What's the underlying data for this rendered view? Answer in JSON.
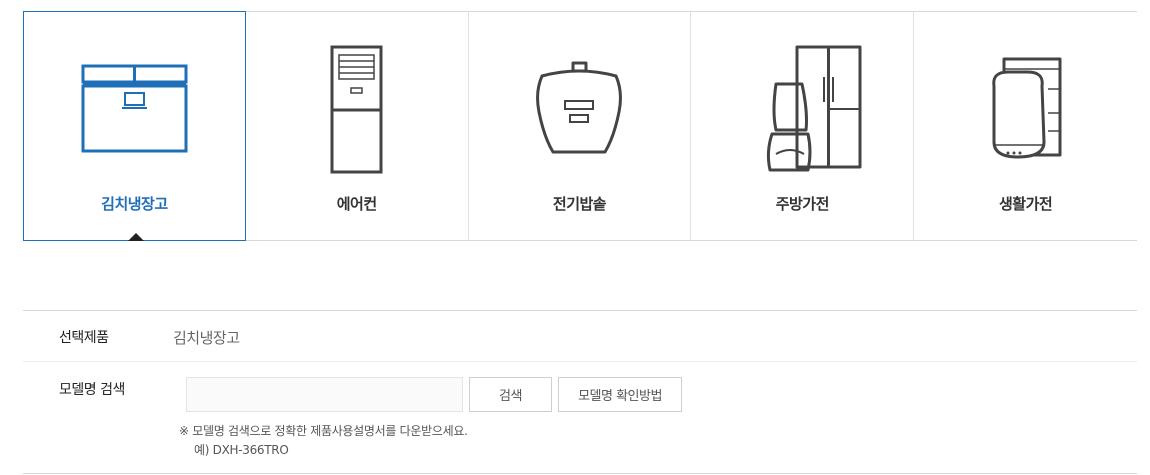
{
  "categories": [
    {
      "label": "김치냉장고",
      "icon": "kimchi-refrigerator-icon",
      "active": true
    },
    {
      "label": "에어컨",
      "icon": "air-conditioner-icon",
      "active": false
    },
    {
      "label": "전기밥솥",
      "icon": "rice-cooker-icon",
      "active": false
    },
    {
      "label": "주방가전",
      "icon": "kitchen-appliance-icon",
      "active": false
    },
    {
      "label": "생활가전",
      "icon": "home-appliance-icon",
      "active": false
    }
  ],
  "colors": {
    "accent": "#1f6fb8",
    "icon_stroke": "#444444",
    "border": "#d8d8d8"
  },
  "form": {
    "selected_product_label": "선택제품",
    "selected_product_value": "김치냉장고",
    "model_search_label": "모델명 검색",
    "model_search_input_value": "",
    "search_button": "검색",
    "howto_button": "모델명 확인방법",
    "notice_line1": "※ 모델명 검색으로 정확한 제품사용설명서를 다운받으세요.",
    "notice_line2": "예) DXH-366TRO"
  }
}
